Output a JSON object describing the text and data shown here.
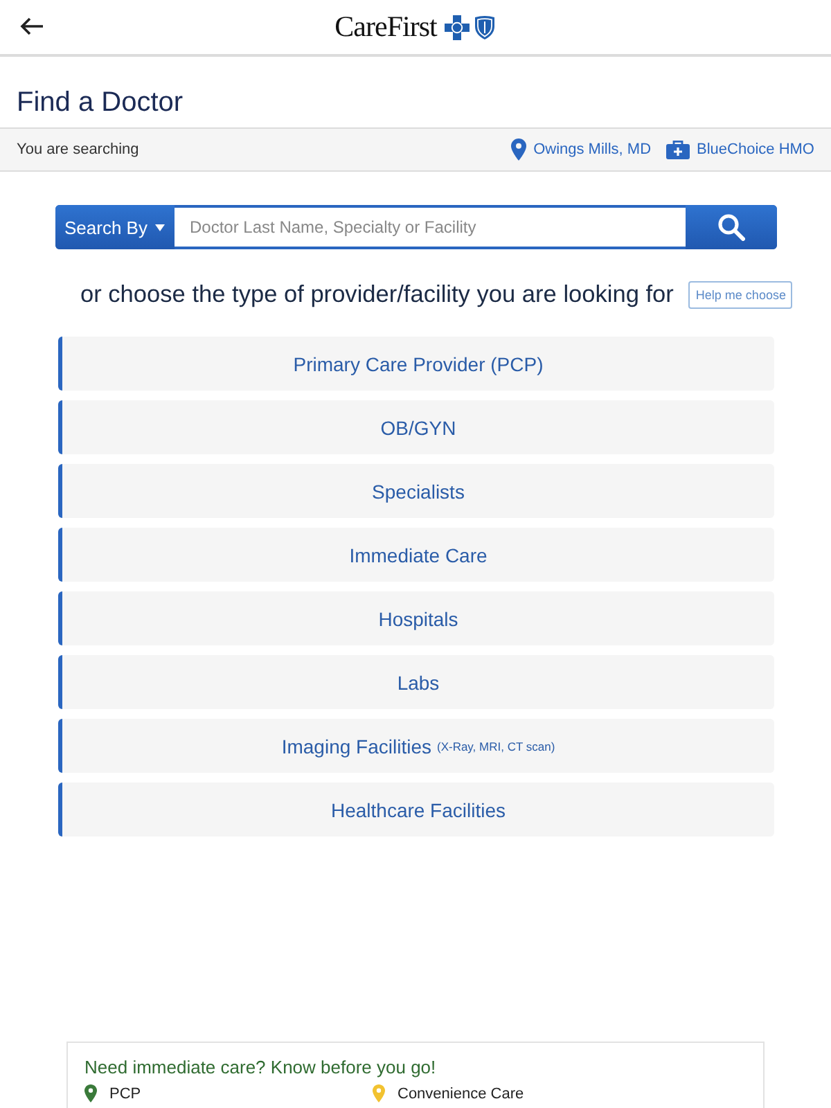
{
  "header": {
    "logo_text": "CareFirst"
  },
  "page_title": "Find a Doctor",
  "search_context": {
    "label": "You are searching",
    "location": "Owings Mills, MD",
    "plan": "BlueChoice HMO"
  },
  "search": {
    "search_by": "Search By",
    "placeholder": "Doctor Last Name, Specialty or Facility"
  },
  "prompt": {
    "text": "or choose the type of provider/facility you are looking for",
    "help_button": "Help me choose"
  },
  "provider_types": [
    {
      "label": "Primary Care Provider (PCP)"
    },
    {
      "label": "OB/GYN"
    },
    {
      "label": "Specialists"
    },
    {
      "label": "Immediate Care"
    },
    {
      "label": "Hospitals"
    },
    {
      "label": "Labs"
    },
    {
      "label": "Imaging Facilities",
      "note": "(X-Ray, MRI, CT scan)"
    },
    {
      "label": "Healthcare Facilities"
    }
  ],
  "info_card": {
    "title": "Need immediate care? Know before you go!",
    "legend": [
      {
        "label": "PCP",
        "color": "#3a7a3a"
      },
      {
        "label": "Convenience Care",
        "color": "#f2c230"
      }
    ]
  }
}
